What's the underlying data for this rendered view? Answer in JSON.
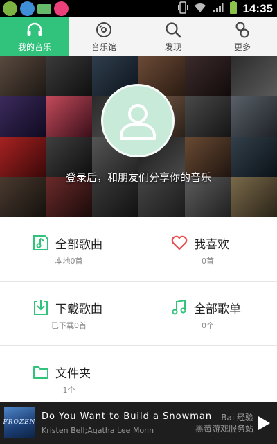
{
  "status_bar": {
    "time": "14:35",
    "app_icons": [
      "#7cb342",
      "#3f8fd8",
      "#66bb6a",
      "#ec407a"
    ]
  },
  "tabs": [
    {
      "label": "我的音乐",
      "icon": "headphones-icon",
      "active": true
    },
    {
      "label": "音乐馆",
      "icon": "disc-icon",
      "active": false
    },
    {
      "label": "发现",
      "icon": "search-icon",
      "active": false
    },
    {
      "label": "更多",
      "icon": "more-icon",
      "active": false
    }
  ],
  "banner": {
    "login_prompt": "登录后，和朋友们分享你的音乐"
  },
  "library": [
    {
      "title": "全部歌曲",
      "subtitle": "本地0首",
      "icon": "music-note-icon"
    },
    {
      "title": "我喜欢",
      "subtitle": "0首",
      "icon": "heart-icon"
    },
    {
      "title": "下载歌曲",
      "subtitle": "已下载0首",
      "icon": "download-icon"
    },
    {
      "title": "全部歌单",
      "subtitle": "0个",
      "icon": "playlist-icon"
    },
    {
      "title": "文件夹",
      "subtitle": "1个",
      "icon": "folder-icon"
    }
  ],
  "player": {
    "song": "Do You Want to Build a Snowman",
    "artist": "Kristen Bell;Agatha Lee Monn",
    "cover_text": "FROZEN",
    "watermark_line1": "Bai 经验",
    "watermark_line2": "黑莓游戏服务站"
  },
  "colors": {
    "accent": "#31c27c",
    "icon_green": "#31c27c",
    "heart_red": "#e94e4e",
    "player_bg": "#1e1e1e"
  }
}
